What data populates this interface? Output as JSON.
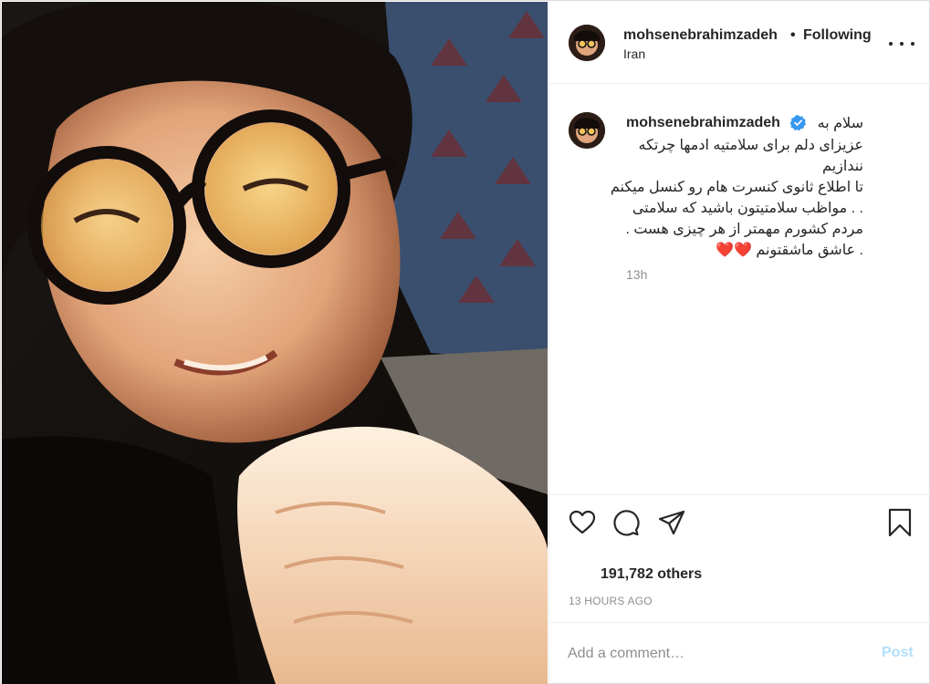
{
  "post": {
    "username": "mohsenebrahimzadeh",
    "separator": "•",
    "follow_status": "Following",
    "location": "Iran",
    "more_icon": "more-horizontal-icon"
  },
  "caption": {
    "username": "mohsenebrahimzadeh",
    "verified_icon": "verified-badge-icon",
    "first_line": "سلام به",
    "lines": [
      "عزیزای دلم برای سلامتیه ادمها چرتکه",
      "نندازیم",
      "تا اطلاع ثانوی کنسرت هام رو کنسل میکنم",
      ". . مواظب سلامتیتون باشید که سلامتی",
      "مردم کشورم مهمتر از هر چیزی هست .",
      ". عاشق ماشقتونم ❤️❤️"
    ],
    "time": "13h"
  },
  "actions": {
    "like_icon": "heart-icon",
    "comment_icon": "comment-icon",
    "share_icon": "share-icon",
    "save_icon": "bookmark-icon"
  },
  "likes_text": "191,782 others",
  "post_time": "13 HOURS AGO",
  "comment_box": {
    "placeholder": "Add a comment…",
    "post_label": "Post"
  },
  "colors": {
    "verified": "#3897f0",
    "post_disabled": "#b2dffc",
    "muted_text": "#8e8e8e",
    "border": "#efefef"
  }
}
